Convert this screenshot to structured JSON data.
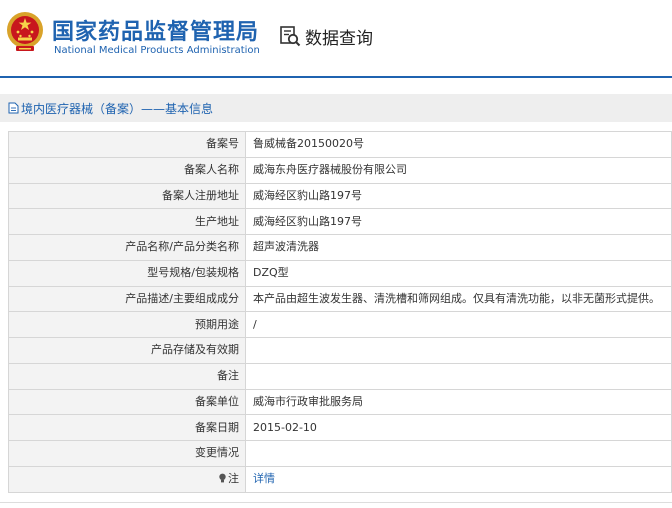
{
  "header": {
    "agency_name_cn": "国家药品监督管理局",
    "agency_name_en": "National Medical Products Administration",
    "search_title": "数据查询",
    "brand_color": "#1f63b0",
    "emblem_icon": "national-emblem-icon",
    "search_icon": "data-search-icon"
  },
  "breadcrumb": {
    "text": "境内医疗器械（备案）——基本信息",
    "icon": "document-icon"
  },
  "record": {
    "rows": [
      {
        "label": "备案号",
        "value": "鲁威械备20150020号"
      },
      {
        "label": "备案人名称",
        "value": "威海东舟医疗器械股份有限公司"
      },
      {
        "label": "备案人注册地址",
        "value": "威海经区豹山路197号"
      },
      {
        "label": "生产地址",
        "value": "威海经区豹山路197号"
      },
      {
        "label": "产品名称/产品分类名称",
        "value": "超声波清洗器"
      },
      {
        "label": "型号规格/包装规格",
        "value": "DZQ型"
      },
      {
        "label": "产品描述/主要组成成分",
        "value": "本产品由超生波发生器、清洗槽和筛网组成。仅具有清洗功能，以非无菌形式提供。"
      },
      {
        "label": "预期用途",
        "value": "/"
      },
      {
        "label": "产品存储及有效期",
        "value": ""
      },
      {
        "label": "备注",
        "value": ""
      },
      {
        "label": "备案单位",
        "value": "威海市行政审批服务局"
      },
      {
        "label": "备案日期",
        "value": "2015-02-10"
      },
      {
        "label": "变更情况",
        "value": ""
      },
      {
        "label": "注",
        "value": "详情",
        "icon": "lightbulb-icon"
      }
    ]
  }
}
